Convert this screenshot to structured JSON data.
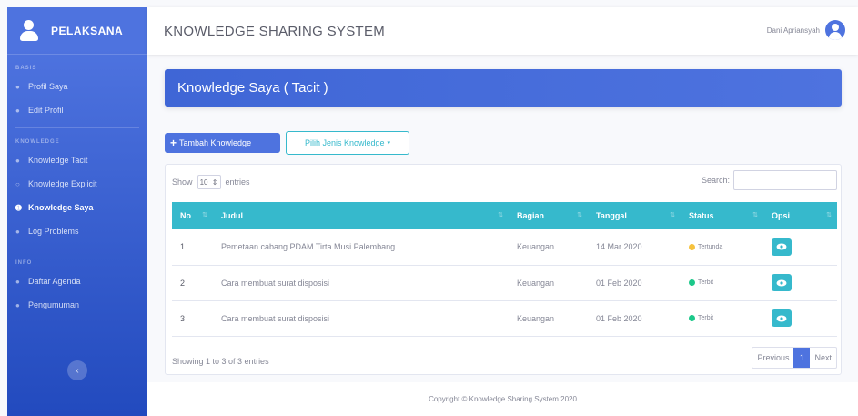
{
  "sidebar": {
    "brand": "PELAKSANA",
    "sections": [
      {
        "heading": "BASIS",
        "items": [
          {
            "label": "Profil Saya",
            "icon": "user-icon"
          },
          {
            "label": "Edit Profil",
            "icon": "user-edit-icon"
          }
        ]
      },
      {
        "heading": "KNOWLEDGE",
        "items": [
          {
            "label": "Knowledge Tacit",
            "icon": "lightbulb-icon"
          },
          {
            "label": "Knowledge Explicit",
            "icon": "lightbulb-outline-icon"
          },
          {
            "label": "Knowledge Saya",
            "icon": "info-circle-icon",
            "active": true
          },
          {
            "label": "Log Problems",
            "icon": "clock-icon"
          }
        ]
      },
      {
        "heading": "INFO",
        "items": [
          {
            "label": "Daftar Agenda",
            "icon": "clock-icon"
          },
          {
            "label": "Pengumuman",
            "icon": "bell-icon"
          }
        ]
      }
    ],
    "toggle_icon": "chevron-left-icon"
  },
  "topbar": {
    "title": "KNOWLEDGE SHARING SYSTEM",
    "user_name": "Dani Apriansyah",
    "avatar_icon": "user-circle-icon"
  },
  "page_header": {
    "title": "Knowledge Saya ( Tacit )"
  },
  "actions": {
    "add_label": "Tambah Knowledge",
    "add_icon": "plus-icon",
    "type_label": "Pilih Jenis Knowledge"
  },
  "table": {
    "show_label": "Show",
    "length_value": "10",
    "entries_label": "entries",
    "search_label": "Search:",
    "columns": [
      "No",
      "Judul",
      "Bagian",
      "Tanggal",
      "Status",
      "Opsi"
    ],
    "rows": [
      {
        "no": "1",
        "judul": "Pemetaan cabang PDAM Tirta Musi Palembang",
        "bagian": "Keuangan",
        "tanggal": "14 Mar 2020",
        "status": "Tertunda",
        "status_color": "#f6c23e"
      },
      {
        "no": "2",
        "judul": "Cara membuat surat disposisi",
        "bagian": "Keuangan",
        "tanggal": "01 Feb 2020",
        "status": "Terbit",
        "status_color": "#1cc88a"
      },
      {
        "no": "3",
        "judul": "Cara membuat surat disposisi",
        "bagian": "Keuangan",
        "tanggal": "01 Feb 2020",
        "status": "Terbit",
        "status_color": "#1cc88a"
      }
    ],
    "info": "Showing 1 to 3 of 3 entries",
    "pagination": {
      "previous": "Previous",
      "current": "1",
      "next": "Next"
    }
  },
  "footer": {
    "copyright": "Copyright © Knowledge Sharing System 2020"
  },
  "colors": {
    "primary": "#4e73df",
    "info": "#36b9cc",
    "warning": "#f6c23e",
    "success": "#1cc88a"
  }
}
